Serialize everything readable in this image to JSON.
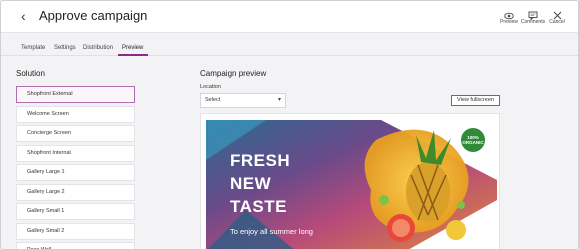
{
  "header": {
    "title": "Approve campaign",
    "actions": [
      {
        "label": "Preview",
        "icon": "eye-icon"
      },
      {
        "label": "Comments",
        "icon": "comment-icon"
      },
      {
        "label": "Cancel",
        "icon": "close-icon"
      }
    ]
  },
  "tabs": [
    "Template",
    "Settings",
    "Distribution",
    "Preview"
  ],
  "active_tab": "Preview",
  "solution": {
    "title": "Solution",
    "items": [
      "Shopfront External",
      "Welcome Screen",
      "Concierge Screen",
      "Shopfront Internal",
      "Gallery Large 1",
      "Gallery Large 2",
      "Gallery Small 1",
      "Gallery Small 2",
      "Pass Wall"
    ],
    "selected": "Shopfront External"
  },
  "campaign_preview": {
    "title": "Campaign preview",
    "location_label": "Location",
    "location_value": "Select",
    "view_fullscreen": "View fullscreen",
    "banner": {
      "lines": [
        "FRESH",
        "NEW",
        "TASTE"
      ],
      "subtitle": "To enjoy all summer long",
      "badge": "100% ORGANIC"
    }
  },
  "colors": {
    "accent": "#8a2b86",
    "badge": "#2f8a3a"
  }
}
